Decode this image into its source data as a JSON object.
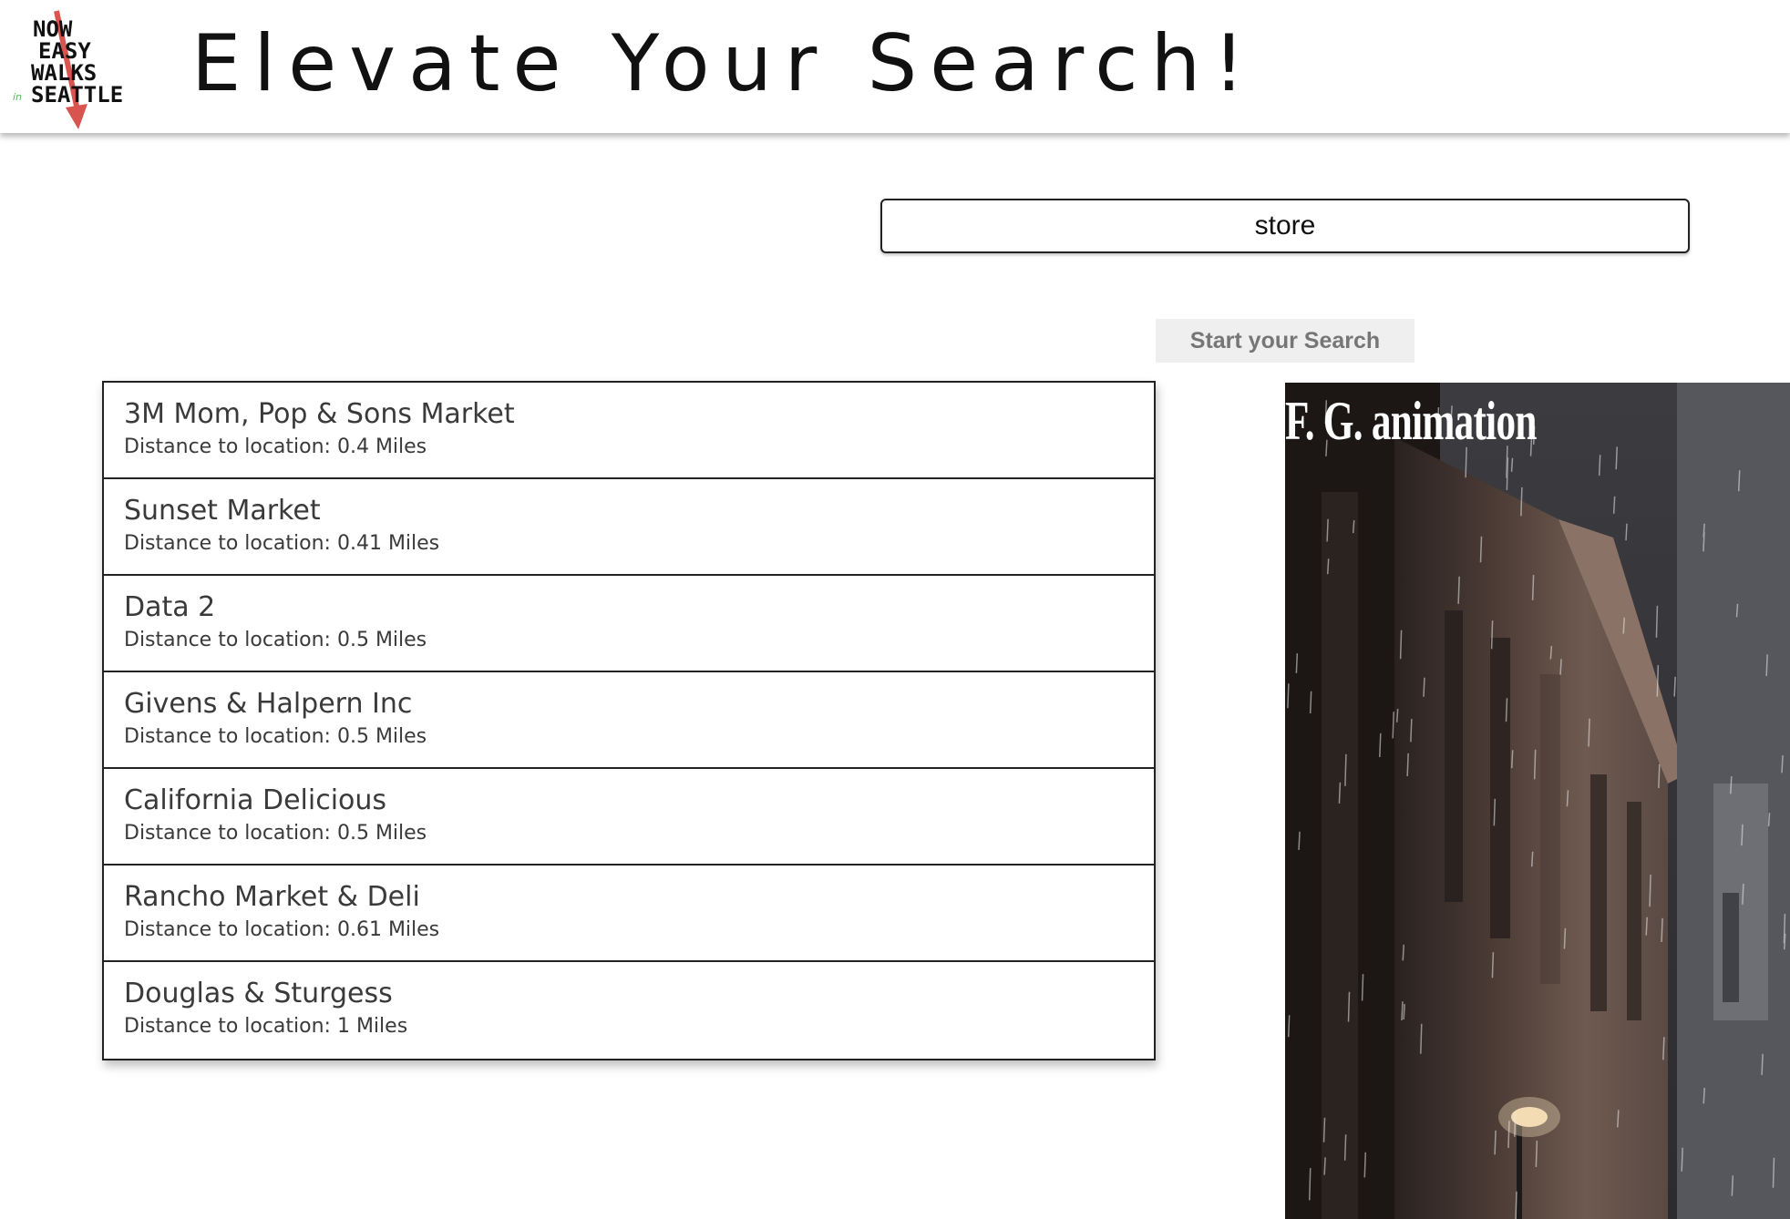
{
  "header": {
    "logo": {
      "icon": "now-easy-walks-in-seattle-logo",
      "lines": [
        "NOW",
        "EASY",
        "WALKS",
        "SEATTLE"
      ],
      "small_word": "in",
      "arrow_color": "#d9534f",
      "small_word_color": "#5cb85c"
    },
    "title": "Elevate Your Search!"
  },
  "search": {
    "value": "store",
    "button_label": "Start your Search"
  },
  "results": [
    {
      "name": "3M Mom, Pop & Sons Market",
      "distance": "Distance to location: 0.4 Miles"
    },
    {
      "name": "Sunset Market",
      "distance": "Distance to location: 0.41 Miles"
    },
    {
      "name": "Data 2",
      "distance": "Distance to location: 0.5 Miles"
    },
    {
      "name": "Givens & Halpern Inc",
      "distance": "Distance to location: 0.5 Miles"
    },
    {
      "name": "California Delicious",
      "distance": "Distance to location: 0.5 Miles"
    },
    {
      "name": "Rancho Market & Deli",
      "distance": "Distance to location: 0.61 Miles"
    },
    {
      "name": "Douglas & Sturgess",
      "distance": "Distance to location: 1 Miles"
    }
  ],
  "animation": {
    "caption": "F. G. animation",
    "scene": "rainy-street-animation"
  }
}
